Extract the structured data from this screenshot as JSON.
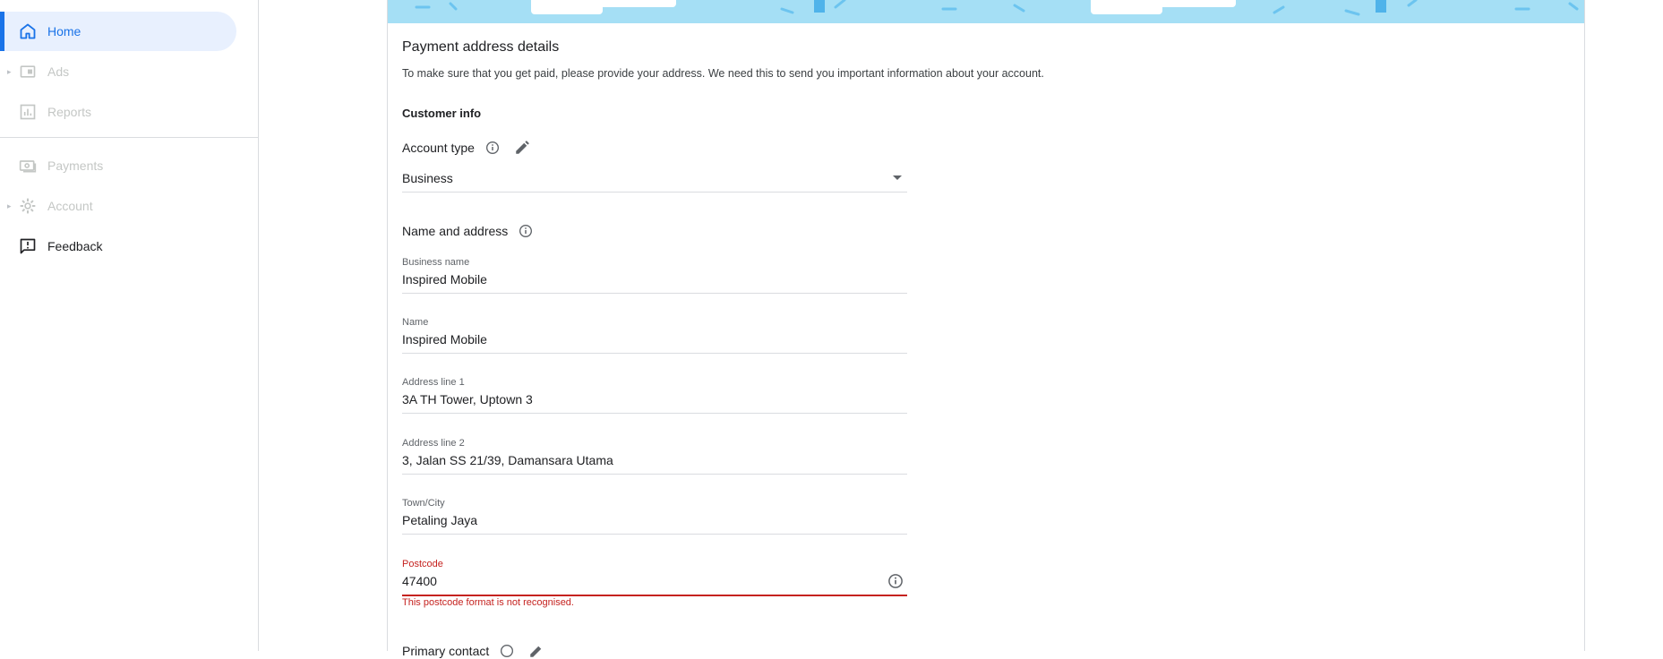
{
  "sidebar": {
    "items": [
      {
        "label": "Home",
        "icon": "home-icon",
        "state": "active"
      },
      {
        "label": "Ads",
        "icon": "ads-icon",
        "state": "disabled"
      },
      {
        "label": "Reports",
        "icon": "reports-icon",
        "state": "disabled"
      },
      {
        "label": "Payments",
        "icon": "payments-icon",
        "state": "disabled"
      },
      {
        "label": "Account",
        "icon": "gear-icon",
        "state": "disabled"
      },
      {
        "label": "Feedback",
        "icon": "feedback-icon",
        "state": "normal"
      }
    ]
  },
  "card": {
    "title": "Payment address details",
    "description": "To make sure that you get paid, please provide your address. We need this to send you important information about your account.",
    "customer_info_heading": "Customer info",
    "account_type": {
      "label": "Account type",
      "value": "Business"
    },
    "name_and_address_heading": "Name and address",
    "fields": {
      "business_name": {
        "label": "Business name",
        "value": "Inspired Mobile"
      },
      "name": {
        "label": "Name",
        "value": "Inspired Mobile"
      },
      "address_line_1": {
        "label": "Address line 1",
        "value": "3A TH Tower, Uptown 3"
      },
      "address_line_2": {
        "label": "Address line 2",
        "value": "3, Jalan SS 21/39, Damansara Utama"
      },
      "town_city": {
        "label": "Town/City",
        "value": "Petaling Jaya"
      },
      "postcode": {
        "label": "Postcode",
        "value": "47400",
        "error": "This postcode format is not recognised."
      }
    },
    "primary_contact_heading": "Primary contact"
  },
  "colors": {
    "accent": "#1a73e8",
    "active_bg": "#e8f0fe",
    "error": "#c5221f",
    "banner": "#a5dff5"
  }
}
